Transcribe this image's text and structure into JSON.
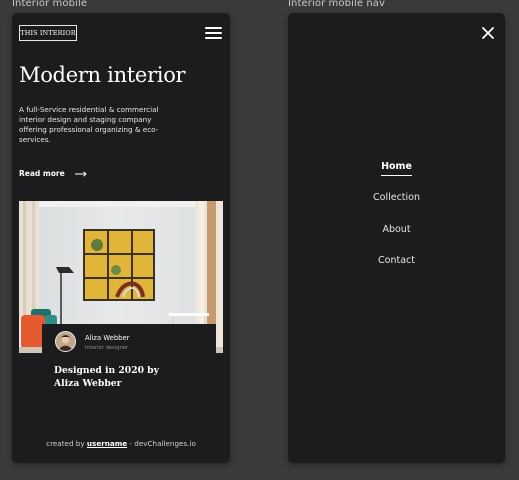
{
  "frames": {
    "mobile": {
      "label": "Interior mobile"
    },
    "nav": {
      "label": "Interior mobile nav"
    }
  },
  "header": {
    "logo_text": "THIS INTERIOR",
    "menu_icon": "hamburger-menu-icon"
  },
  "hero": {
    "title": "Modern interior",
    "description": "A full-Service residential & commercial interior design and staging company offering professional organizing & eco-services.",
    "read_more_label": "Read more",
    "arrow_icon": "arrow-right-icon"
  },
  "card": {
    "author_name": "Aliza Webber",
    "author_role": "Interior designer",
    "title": "Designed in 2020 by Aliza Webber"
  },
  "footer": {
    "prefix": "created by",
    "username": "username",
    "suffix": "- devChallenges.io"
  },
  "nav": {
    "close_icon": "close-icon",
    "items": [
      {
        "label": "Home",
        "active": true
      },
      {
        "label": "Collection",
        "active": false
      },
      {
        "label": "About",
        "active": false
      },
      {
        "label": "Contact",
        "active": false
      }
    ]
  },
  "colors": {
    "canvas": "#3a3a3a",
    "frame": "#1c1c1e",
    "text": "#ffffff",
    "muted": "#8e8e8e"
  }
}
